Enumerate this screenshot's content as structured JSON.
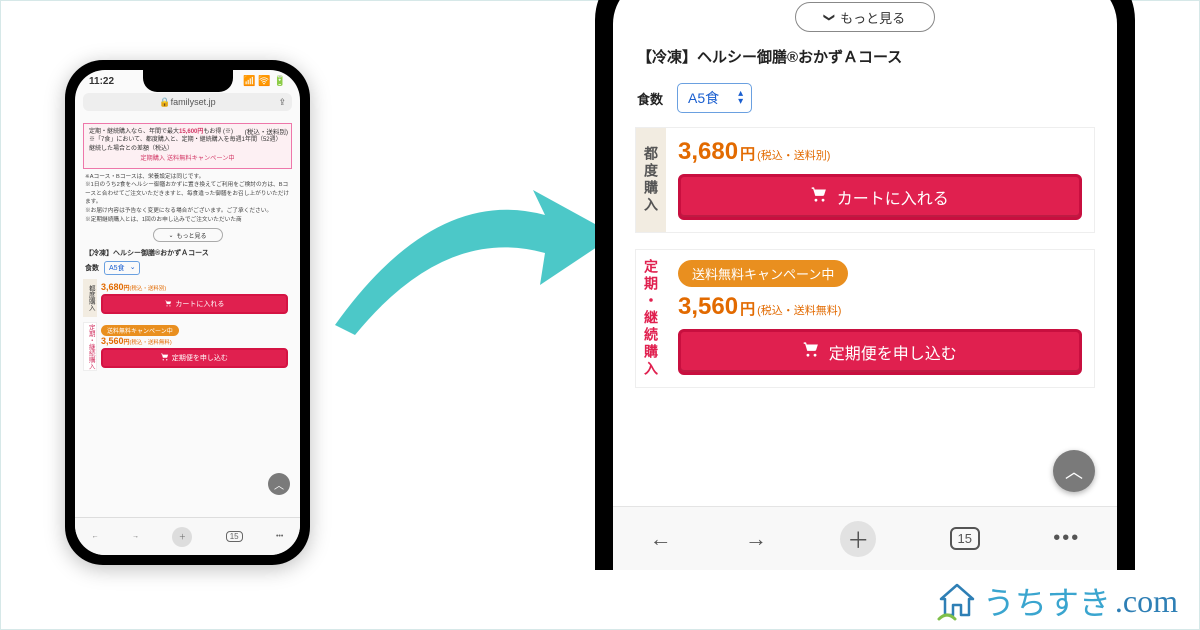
{
  "status_bar": {
    "time": "11:22"
  },
  "url_bar": {
    "domain": "familyset.jp"
  },
  "top_tax_note": "(税込・送料別)",
  "pink_box": {
    "line1_pre": "定期・継続購入なら、年間で最大",
    "line1_amount": "15,600円",
    "line1_post": "もお得 (※)",
    "line2": "※「7食」において、都度購入と、定期・継続購入を毎週1年間（52週）継続した場合との差額（税込）",
    "campaign": "定期購入 送料無料キャンペーン中"
  },
  "notes": {
    "n1": "※Aコース・Bコースは、栄養設定は同じです。",
    "n2": "※1日のうち2食をヘルシー御膳おかずに置き換えてご利用をご検討の方は、Bコースと合わせてご注文いただきますと、毎食違った御膳をお召し上がりいただけます。",
    "n3": "※お届け内容は予告なく変更になる場合がございます。ご了承ください。",
    "n4": "※定期継続購入とは、1回のお申し込みでご注文いただいた商"
  },
  "more_button": "もっと見る",
  "product_title": "【冷凍】ヘルシー御膳®おかずＡコース",
  "quantity": {
    "label": "食数",
    "value": "A5食"
  },
  "one_time": {
    "vlabel": "都度購入",
    "price": "3,680",
    "yen": "円",
    "tax": "(税込・送料別)",
    "button": "カートに入れる"
  },
  "subscription": {
    "vlabel": "定期・継続購入",
    "pill": "送料無料キャンペーン中",
    "price": "3,560",
    "yen": "円",
    "tax": "(税込・送料無料)",
    "button": "定期便を申し込む"
  },
  "browser_nav": {
    "tab_count": "15"
  },
  "watermark": {
    "text": "うちすき",
    "suffix": ".com"
  }
}
